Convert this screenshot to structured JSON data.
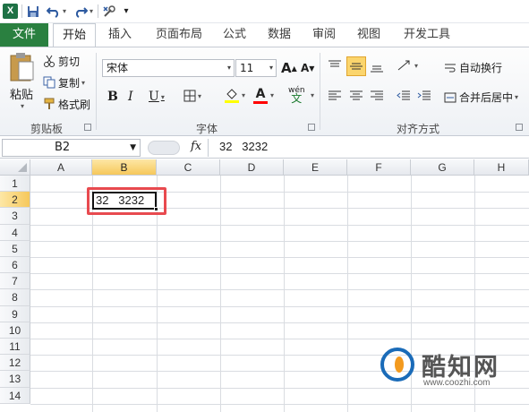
{
  "quick_access": {
    "app_icon": "excel-logo",
    "app_letter": "X",
    "save_icon": "save-icon",
    "undo_icon": "undo-icon",
    "redo_icon": "redo-icon",
    "tools_icon": "tools-icon",
    "customize_icon": "customize-arrow-icon"
  },
  "tabs": [
    {
      "label": "文件"
    },
    {
      "label": "开始"
    },
    {
      "label": "插入"
    },
    {
      "label": "页面布局"
    },
    {
      "label": "公式"
    },
    {
      "label": "数据"
    },
    {
      "label": "审阅"
    },
    {
      "label": "视图"
    },
    {
      "label": "开发工具"
    }
  ],
  "ribbon": {
    "clipboard": {
      "paste": "粘贴",
      "cut": "剪切",
      "copy": "复制",
      "format_painter": "格式刷",
      "group_label": "剪贴板"
    },
    "font": {
      "font_name": "宋体",
      "font_size": "11",
      "grow": "A",
      "shrink": "A",
      "bold": "B",
      "italic": "I",
      "underline": "U",
      "font_color_letter": "A",
      "phonetic": "wén",
      "group_label": "字体"
    },
    "alignment": {
      "wrap_text": "自动换行",
      "merge_center": "合并后居中",
      "group_label": "对齐方式"
    },
    "colors": {
      "fill_highlight": "#ffff00",
      "font_color": "#ff0000",
      "file_tab": "#2a8040"
    }
  },
  "formula_bar": {
    "name_box": "B2",
    "fx_label": "fx",
    "content": "32   3232"
  },
  "sheet": {
    "columns": [
      "A",
      "B",
      "C",
      "D",
      "E",
      "F",
      "G",
      "H"
    ],
    "rows": [
      "1",
      "2",
      "3",
      "4",
      "5",
      "6",
      "7",
      "8",
      "9",
      "10",
      "11",
      "12",
      "13",
      "14"
    ],
    "selected_cell": "B2",
    "cell_b2": "32   3232",
    "highlight_color": "#e84a4f"
  },
  "watermark": {
    "text": "酷知网",
    "url": "www.coozhi.com"
  }
}
